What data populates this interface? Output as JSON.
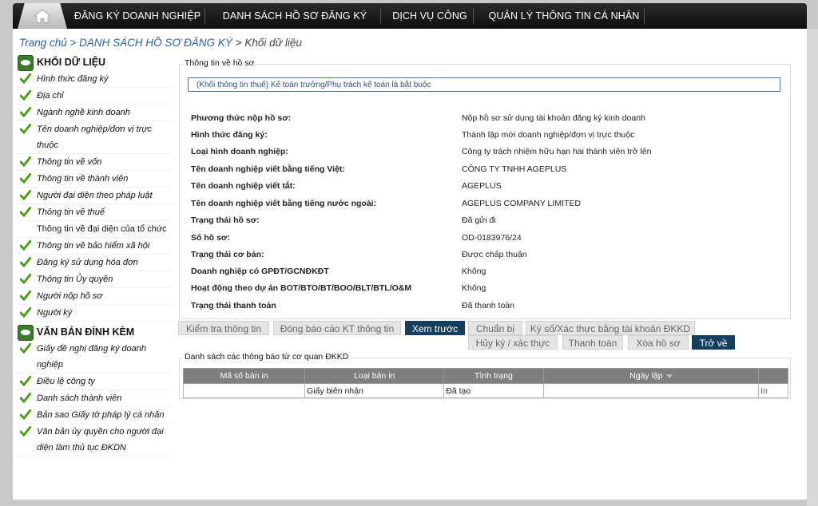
{
  "nav": {
    "items": [
      "ĐĂNG KÝ DOANH NGHIỆP",
      "DANH SÁCH HỒ SƠ ĐĂNG KÝ",
      "DỊCH VỤ CÔNG",
      "QUẢN LÝ THÔNG TIN CÁ NHÂN"
    ]
  },
  "breadcrumb": {
    "home": "Trang chủ",
    "sep": " > ",
    "list": "DANH SÁCH HỒ SƠ ĐĂNG KÝ",
    "current": "Khối dữ liệu"
  },
  "sidebar": {
    "section1_title": "KHỐI DỮ LIỆU",
    "section1_items": [
      "Hình thức đăng ký",
      "Địa chỉ",
      "Ngành nghề kinh doanh",
      "Tên doanh nghiệp/đơn vị trực thuộc",
      "Thông tin về vốn",
      "Thông tin về thành viên",
      "Người đại diện theo pháp luật",
      "Thông tin về thuế",
      "Thông tin về đại diện của tổ chức",
      "Thông tin về bảo hiểm xã hội",
      "Đăng ký sử dụng hóa đơn",
      "Thông tin Ủy quyền",
      "Người nộp hồ sơ",
      "Người ký"
    ],
    "section2_title": "VĂN BẢN ĐÍNH KÈM",
    "section2_items": [
      "Giấy đề nghị đăng ký doanh nghiệp",
      "Điều lệ công ty",
      "Danh sách thành viên",
      "Bản sao Giấy tờ pháp lý cá nhân",
      "Văn bản ủy quyền cho người đại diện làm thủ tục ĐKDN"
    ]
  },
  "panel": {
    "legend": "Thông tin về hồ sơ",
    "notice": "(Khối thông tin thuế) Kế toán trưởng/Phụ trách kế toán là bắt buộc",
    "rows": [
      {
        "label": "Phương thức nộp hồ sơ:",
        "value": "Nộp hồ sơ sử dụng tài khoản đăng ký kinh doanh"
      },
      {
        "label": "Hình thức đăng ký:",
        "value": "Thành lập mới doanh nghiệp/đơn vị trực thuộc"
      },
      {
        "label": "Loại hình doanh nghiệp:",
        "value": "Công ty trách nhiệm hữu hạn hai thành viên trở lên"
      },
      {
        "label": "Tên doanh nghiệp viết bằng tiếng Việt:",
        "value": "CÔNG TY TNHH AGEPLUS"
      },
      {
        "label": "Tên doanh nghiệp viết tắt:",
        "value": "AGEPLUS"
      },
      {
        "label": "Tên doanh nghiệp viết bằng tiếng nước ngoài:",
        "value": "AGEPLUS COMPANY LIMITED"
      },
      {
        "label": "Trạng thái hồ sơ:",
        "value": "Đã gửi đi"
      },
      {
        "label": "Số hồ sơ:",
        "value": "OD-0183976/24"
      },
      {
        "label": "Trạng thái cơ bản:",
        "value": "Được chấp thuận"
      },
      {
        "label": "Doanh nghiệp có GPĐT/GCNĐKĐT",
        "value": "Không"
      },
      {
        "label": "Hoạt động theo dự án BOT/BTO/BT/BOO/BLT/BTL/O&M",
        "value": "Không"
      },
      {
        "label": "Trạng thái thanh toán",
        "value": "Đã thanh toán"
      }
    ]
  },
  "buttons": {
    "check": "Kiểm tra thông tin",
    "report_kt": "Đóng báo cáo KT thông tin",
    "preview": "Xem trước",
    "prepare": "Chuẩn bị",
    "sign": "Ký số/Xác thực bằng tài khoản ĐKKD",
    "cancel_sign": "Hủy ký / xác thực",
    "pay": "Thanh toán",
    "delete": "Xóa hồ sơ",
    "back": "Trở về"
  },
  "notices_table": {
    "legend": "Danh sách các thông báo từ cơ quan ĐKKD",
    "columns": [
      "Mã số bản in",
      "Loại bản in",
      "Tình trạng",
      "Ngày lập",
      ""
    ],
    "rows": [
      {
        "code": "",
        "type": "Giấy biên nhận",
        "status": "Đã tạo",
        "date": "",
        "action": "In"
      }
    ]
  }
}
